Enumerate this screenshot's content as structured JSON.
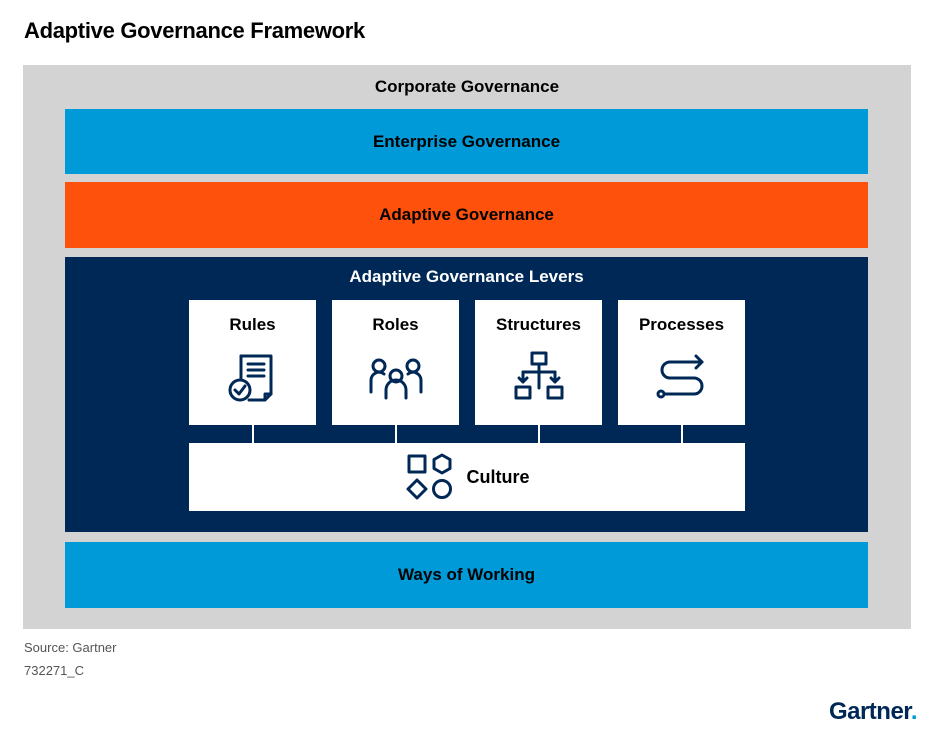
{
  "title": "Adaptive Governance Framework",
  "corporate_governance": "Corporate Governance",
  "enterprise_governance": "Enterprise Governance",
  "adaptive_governance": "Adaptive Governance",
  "levers": {
    "title": "Adaptive Governance Levers",
    "items": [
      {
        "label": "Rules",
        "icon": "document-check-icon"
      },
      {
        "label": "Roles",
        "icon": "people-group-icon"
      },
      {
        "label": "Structures",
        "icon": "hierarchy-icon"
      },
      {
        "label": "Processes",
        "icon": "process-path-icon"
      }
    ],
    "culture": {
      "label": "Culture",
      "icon": "shapes-icon"
    }
  },
  "ways_of_working": "Ways of Working",
  "source": "Source: Gartner",
  "code": "732271_C",
  "logo": "Gartner",
  "colors": {
    "outer": "#d3d3d3",
    "blue": "#009ad9",
    "orange": "#fe520c",
    "navy": "#002856",
    "icon": "#002856"
  }
}
